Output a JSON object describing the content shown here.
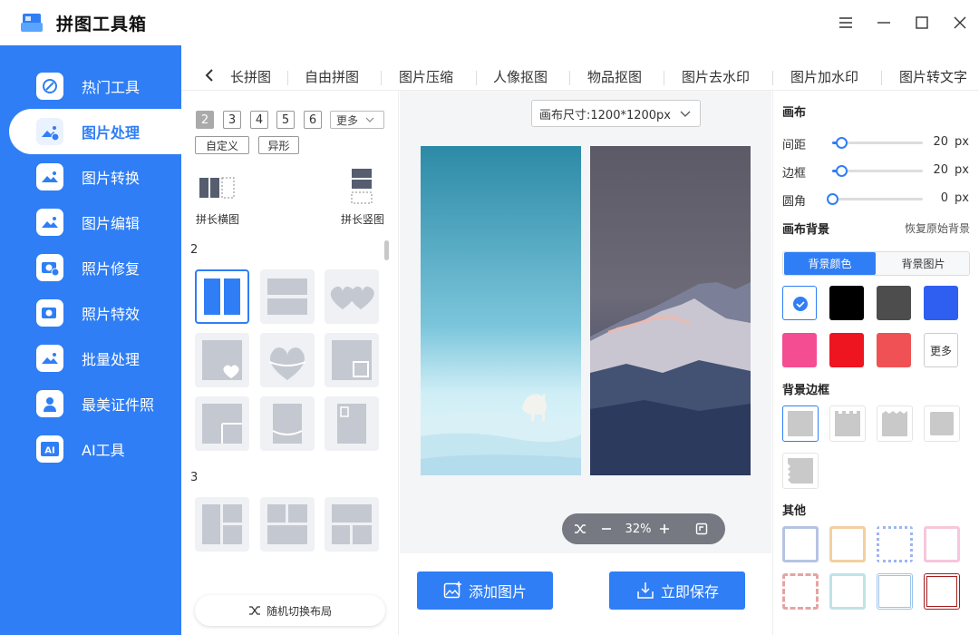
{
  "app": {
    "title": "拼图工具箱"
  },
  "sidebar": {
    "items": [
      {
        "label": "热门工具",
        "icon": "hot-tools-icon"
      },
      {
        "label": "图片处理",
        "icon": "image-process-icon",
        "active": true
      },
      {
        "label": "图片转换",
        "icon": "image-convert-icon"
      },
      {
        "label": "图片编辑",
        "icon": "image-edit-icon"
      },
      {
        "label": "照片修复",
        "icon": "photo-repair-icon"
      },
      {
        "label": "照片特效",
        "icon": "photo-effects-icon"
      },
      {
        "label": "批量处理",
        "icon": "batch-process-icon"
      },
      {
        "label": "最美证件照",
        "icon": "id-photo-icon"
      },
      {
        "label": "AI工具",
        "icon": "ai-tools-icon"
      }
    ]
  },
  "tabs": [
    "长拼图",
    "自由拼图",
    "图片压缩",
    "人像抠图",
    "物品抠图",
    "图片去水印",
    "图片加水印",
    "图片转文字"
  ],
  "layout_panel": {
    "counts": [
      "2",
      "3",
      "4",
      "5",
      "6"
    ],
    "more_label": "更多",
    "custom_label": "自定义",
    "shaped_label": "异形",
    "long_horizontal_label": "拼长横图",
    "long_vertical_label": "拼长竖图",
    "section_2": "2",
    "section_3": "3",
    "random_label": "随机切换布局"
  },
  "canvas": {
    "size_label": "画布尺寸:1200*1200px",
    "zoom": "32%",
    "add_image_label": "添加图片",
    "save_label": "立即保存"
  },
  "right_panel": {
    "canvas_heading": "画布",
    "spacing_label": "间距",
    "spacing_value": "20",
    "spacing_unit": "px",
    "spacing_fraction": 0.1,
    "border_label": "边框",
    "border_value": "20",
    "border_unit": "px",
    "border_fraction": 0.1,
    "corner_label": "圆角",
    "corner_value": "0",
    "corner_unit": "px",
    "corner_fraction": 0,
    "bg_heading": "画布背景",
    "restore_label": "恢复原始背景",
    "bg_color_tab": "背景颜色",
    "bg_image_tab": "背景图片",
    "colors": [
      "#ffffff",
      "#000000",
      "#4d4d4d",
      "#2f5ff0",
      "#f44d91",
      "#ee1520",
      "#ef5155"
    ],
    "more_colors": "更多",
    "border_heading": "背景边框",
    "other_heading": "其他"
  },
  "colors": {
    "accent": "#2f7ef5"
  }
}
